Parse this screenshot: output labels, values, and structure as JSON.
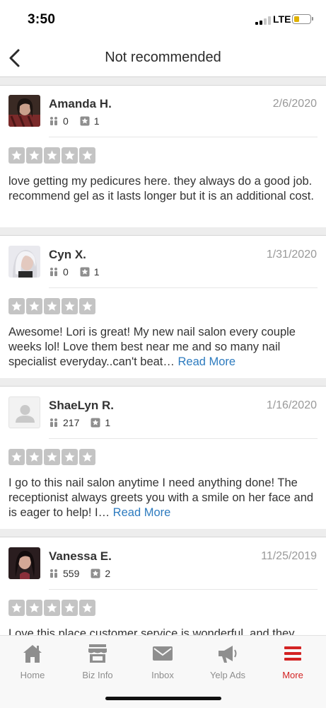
{
  "status_bar": {
    "time": "3:50",
    "network": "LTE",
    "battery_level": 0.35
  },
  "header": {
    "title": "Not recommended",
    "back_icon": "chevron-left-icon"
  },
  "reviews": [
    {
      "name": "Amanda H.",
      "date": "2/6/2020",
      "friends": "0",
      "reviews": "1",
      "rating": 0,
      "text": "love getting my pedicures here. they always do a good job. recommend gel as it lasts longer but it is an additional cost.",
      "read_more": ""
    },
    {
      "name": "Cyn X.",
      "date": "1/31/2020",
      "friends": "0",
      "reviews": "1",
      "rating": 0,
      "text": "Awesome! Lori is great! My new nail salon every  couple weeks lol! Love them best near me and so many nail specialist everyday..can't beat…",
      "read_more": "Read More"
    },
    {
      "name": "ShaeLyn R.",
      "date": "1/16/2020",
      "friends": "217",
      "reviews": "1",
      "rating": 0,
      "text": "I go to this nail salon anytime I need anything done! The receptionist always greets you with a smile on her face and is eager to help! I…",
      "read_more": "Read More"
    },
    {
      "name": "Vanessa E.",
      "date": "11/25/2019",
      "friends": "559",
      "reviews": "2",
      "rating": 0,
      "text": "Love this place customer service is wonderful, and they",
      "read_more": ""
    }
  ],
  "tabbar": {
    "home": "Home",
    "biz_info": "Biz Info",
    "inbox": "Inbox",
    "yelp_ads": "Yelp Ads",
    "more": "More",
    "active": "More"
  },
  "colors": {
    "accent": "#d32323",
    "link": "#2d7bbf",
    "star_empty": "#c4c4c4",
    "tab_inactive": "#8e8e8e"
  }
}
